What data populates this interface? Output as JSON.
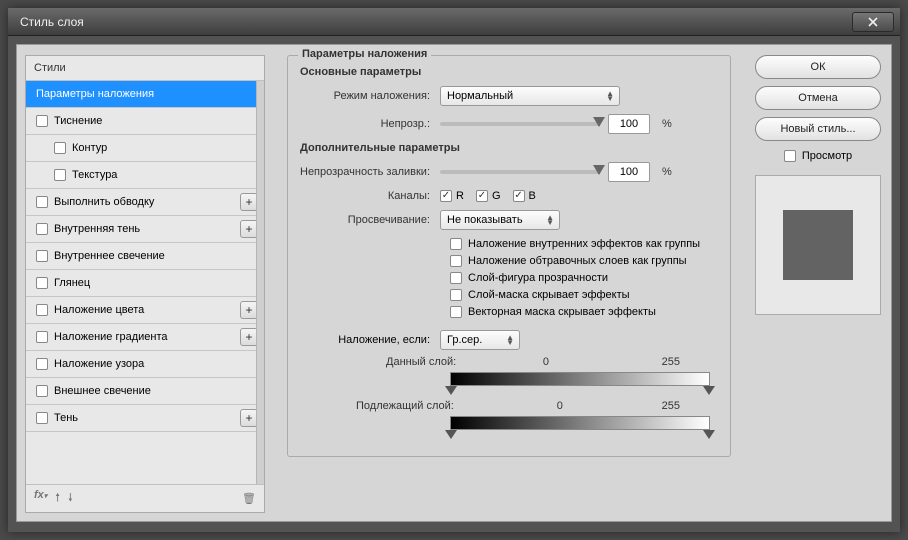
{
  "window": {
    "title": "Стиль слоя"
  },
  "buttons": {
    "ok": "ОК",
    "cancel": "Отмена",
    "newStyle": "Новый стиль...",
    "preview": "Просмотр"
  },
  "stylesPanel": {
    "header": "Стили",
    "items": [
      {
        "label": "Параметры наложения",
        "selected": true,
        "checkbox": false,
        "plus": false,
        "indent": false
      },
      {
        "label": "Тиснение",
        "selected": false,
        "checkbox": true,
        "plus": false,
        "indent": false
      },
      {
        "label": "Контур",
        "selected": false,
        "checkbox": true,
        "plus": false,
        "indent": true
      },
      {
        "label": "Текстура",
        "selected": false,
        "checkbox": true,
        "plus": false,
        "indent": true
      },
      {
        "label": "Выполнить обводку",
        "selected": false,
        "checkbox": true,
        "plus": true,
        "indent": false
      },
      {
        "label": "Внутренняя тень",
        "selected": false,
        "checkbox": true,
        "plus": true,
        "indent": false
      },
      {
        "label": "Внутреннее свечение",
        "selected": false,
        "checkbox": true,
        "plus": false,
        "indent": false
      },
      {
        "label": "Глянец",
        "selected": false,
        "checkbox": true,
        "plus": false,
        "indent": false
      },
      {
        "label": "Наложение цвета",
        "selected": false,
        "checkbox": true,
        "plus": true,
        "indent": false
      },
      {
        "label": "Наложение градиента",
        "selected": false,
        "checkbox": true,
        "plus": true,
        "indent": false
      },
      {
        "label": "Наложение узора",
        "selected": false,
        "checkbox": true,
        "plus": false,
        "indent": false
      },
      {
        "label": "Внешнее свечение",
        "selected": false,
        "checkbox": true,
        "plus": false,
        "indent": false
      },
      {
        "label": "Тень",
        "selected": false,
        "checkbox": true,
        "plus": true,
        "indent": false
      }
    ]
  },
  "main": {
    "title": "Параметры наложения",
    "basic": {
      "title": "Основные параметры",
      "blendModeLabel": "Режим наложения:",
      "blendModeValue": "Нормальный",
      "opacityLabel": "Непрозр.:",
      "opacityValue": "100",
      "pct": "%"
    },
    "advanced": {
      "title": "Дополнительные параметры",
      "fillOpacityLabel": "Непрозрачность заливки:",
      "fillOpacityValue": "100",
      "pct": "%",
      "channelsLabel": "Каналы:",
      "channels": {
        "r": "R",
        "g": "G",
        "b": "B"
      },
      "knockoutLabel": "Просвечивание:",
      "knockoutValue": "Не показывать",
      "opts": [
        {
          "label": "Наложение внутренних эффектов как группы",
          "checked": false
        },
        {
          "label": "Наложение обтравочных слоев как группы",
          "checked": true
        },
        {
          "label": "Слой-фигура прозрачности",
          "checked": true
        },
        {
          "label": "Слой-маска скрывает эффекты",
          "checked": false
        },
        {
          "label": "Векторная маска скрывает эффекты",
          "checked": false
        }
      ],
      "blendIfLabel": "Наложение, если:",
      "blendIfValue": "Гр.сер.",
      "thisLayerLabel": "Данный слой:",
      "underLayerLabel": "Подлежащий слой:",
      "range0": "0",
      "range255": "255"
    }
  }
}
